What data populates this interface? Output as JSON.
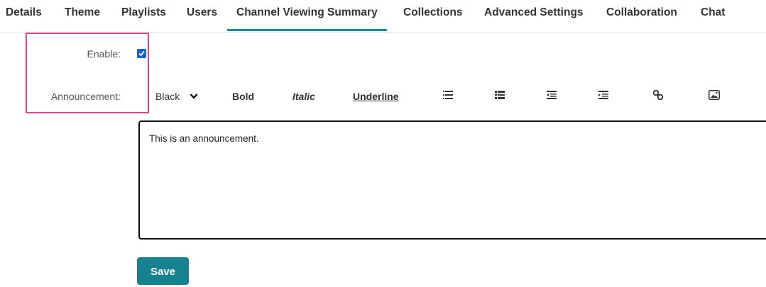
{
  "tabs": [
    {
      "label": "Details"
    },
    {
      "label": "Theme"
    },
    {
      "label": "Playlists"
    },
    {
      "label": "Users"
    },
    {
      "label": "Channel Viewing Summary",
      "active": true
    },
    {
      "label": "Collections"
    },
    {
      "label": "Advanced Settings"
    },
    {
      "label": "Collaboration"
    },
    {
      "label": "Chat"
    }
  ],
  "form": {
    "enable_label": "Enable:",
    "enable_checked": true,
    "announcement_label": "Announcement:"
  },
  "toolbar": {
    "color_select": "Black",
    "bold_label": "Bold",
    "italic_label": "Italic",
    "underline_label": "Underline",
    "icons": [
      "ordered-list-icon",
      "unordered-list-icon",
      "outdent-icon",
      "indent-icon",
      "link-icon",
      "image-icon"
    ]
  },
  "editor": {
    "content": "This is an announcement."
  },
  "save_label": "Save",
  "colors": {
    "accent": "#138ba0",
    "save_button": "#16828f",
    "highlight": "#e0438a",
    "checkbox": "#0c63d8"
  }
}
